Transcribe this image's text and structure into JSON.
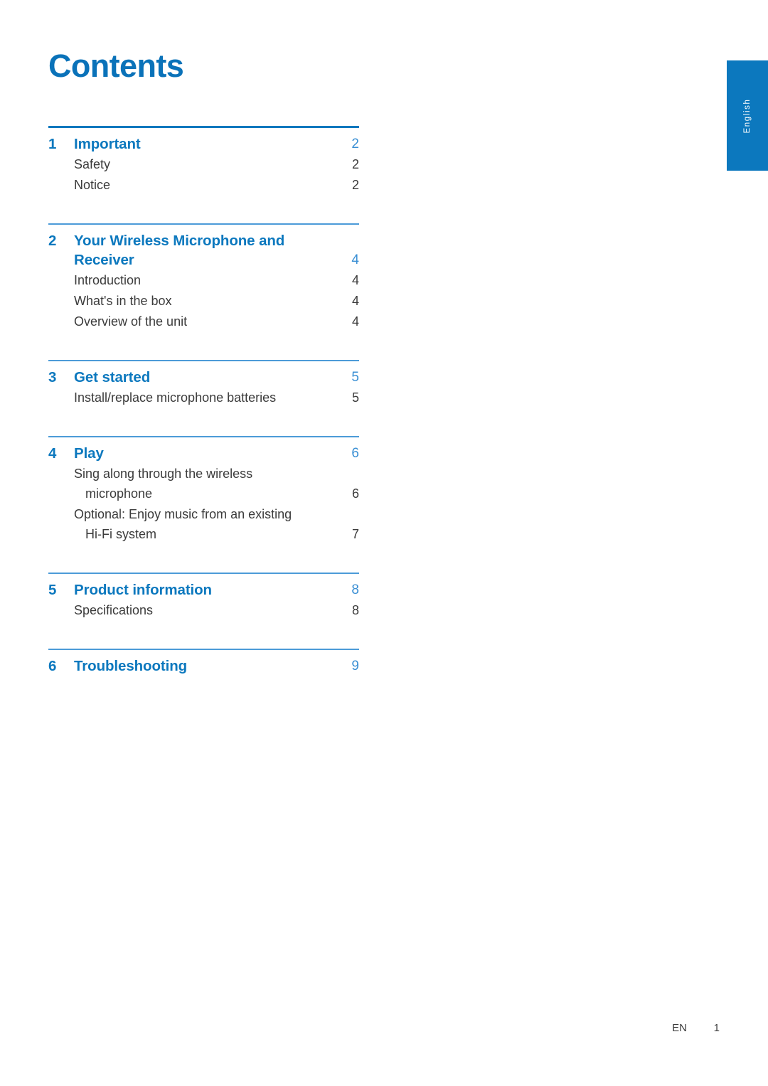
{
  "document": {
    "title": "Contents",
    "language_tab": "English",
    "footer": {
      "language_code": "EN",
      "page_number": "1"
    },
    "colors": {
      "heading_blue": "#0A72B9",
      "rule_blue": "#0C78BE",
      "rule_blue_light": "#4C9BD8",
      "page_number_blue": "#3A8FD4",
      "body_gray": "#3B3B3B",
      "tab_blue": "#0C78BE"
    }
  },
  "toc": {
    "chapters": [
      {
        "number": "1",
        "title": "Important",
        "title_line2": "",
        "page": "2",
        "entries": [
          {
            "text": "Safety",
            "cont": "",
            "page": "2"
          },
          {
            "text": "Notice",
            "cont": "",
            "page": "2"
          }
        ]
      },
      {
        "number": "2",
        "title": "Your Wireless Microphone and",
        "title_line2": "Receiver",
        "page": "4",
        "entries": [
          {
            "text": "Introduction",
            "cont": "",
            "page": "4"
          },
          {
            "text": "What's in the box",
            "cont": "",
            "page": "4"
          },
          {
            "text": "Overview of the unit",
            "cont": "",
            "page": "4"
          }
        ]
      },
      {
        "number": "3",
        "title": "Get started",
        "title_line2": "",
        "page": "5",
        "entries": [
          {
            "text": "Install/replace microphone batteries",
            "cont": "",
            "page": "5"
          }
        ]
      },
      {
        "number": "4",
        "title": "Play",
        "title_line2": "",
        "page": "6",
        "entries": [
          {
            "text": "Sing along through the wireless",
            "cont": "microphone",
            "page": "6"
          },
          {
            "text": "Optional: Enjoy music from an existing",
            "cont": "Hi-Fi system",
            "page": "7"
          }
        ]
      },
      {
        "number": "5",
        "title": "Product information",
        "title_line2": "",
        "page": "8",
        "entries": [
          {
            "text": "Specifications",
            "cont": "",
            "page": "8"
          }
        ]
      },
      {
        "number": "6",
        "title": "Troubleshooting",
        "title_line2": "",
        "page": "9",
        "entries": []
      }
    ]
  }
}
